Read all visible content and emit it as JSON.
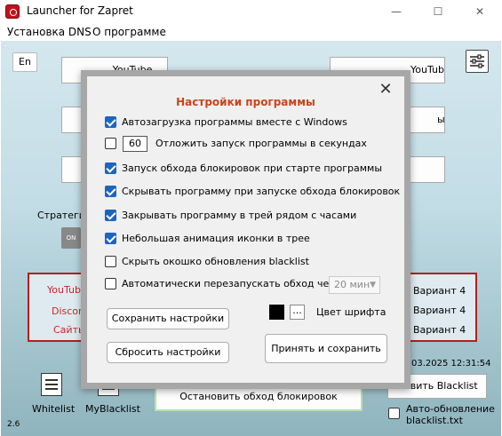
{
  "window": {
    "title": "Launcher for Zapret",
    "minimize_glyph": "—",
    "maximize_glyph": "☐",
    "close_glyph": "✕"
  },
  "menu": {
    "items": [
      "Установка DNS",
      "О программе"
    ]
  },
  "main": {
    "lang_button": "En",
    "left_button_1": "YouTube",
    "right_button_1": "YouTube+Discord",
    "right_button_2": "ы",
    "strategy_label": "Стратеги",
    "toggle_label": "ON",
    "services": [
      "YouTube",
      "Discord",
      "Сайты"
    ],
    "variants": [
      "Вариант 4",
      "Вариант 4",
      "Вариант 4"
    ],
    "date_text": "03.2025 12:31:54",
    "stop_button": "Остановить обход блокировок",
    "update_blacklist_button": "овить Blacklist",
    "auto_update_label_1": "Авто-обновление",
    "auto_update_label_2": "blacklist.txt",
    "whitelist_label": "Whitelist",
    "myblacklist_label": "MyBlacklist",
    "version": "2.6"
  },
  "settings_dialog": {
    "title": "Настройки программы",
    "close_glyph": "✕",
    "options": [
      {
        "label": "Автозагрузка программы вместе с Windows",
        "checked": true
      },
      {
        "label": "Отложить запуск программы в секундах",
        "checked": false,
        "value": "60"
      },
      {
        "label": "Запуск обхода блокировок при старте программы",
        "checked": true
      },
      {
        "label": "Скрывать программу при запуске обхода блокировок",
        "checked": true
      },
      {
        "label": "Закрывать программу в трей рядом с часами",
        "checked": true
      },
      {
        "label": "Небольшая анимация иконки в трее",
        "checked": true
      },
      {
        "label": "Скрыть окошко обновления blacklist",
        "checked": false
      },
      {
        "label": "Автоматически перезапускать обход через",
        "checked": false,
        "combo_value": "20 мин"
      }
    ],
    "save_button": "Сохранить настройки",
    "reset_button": "Сбросить настройки",
    "color_button": "...",
    "font_color_label": "Цвет шрифта",
    "apply_button": "Принять и сохранить",
    "font_color": "#000000",
    "accent_color": "#1a66c1",
    "title_color": "#c8451c"
  }
}
